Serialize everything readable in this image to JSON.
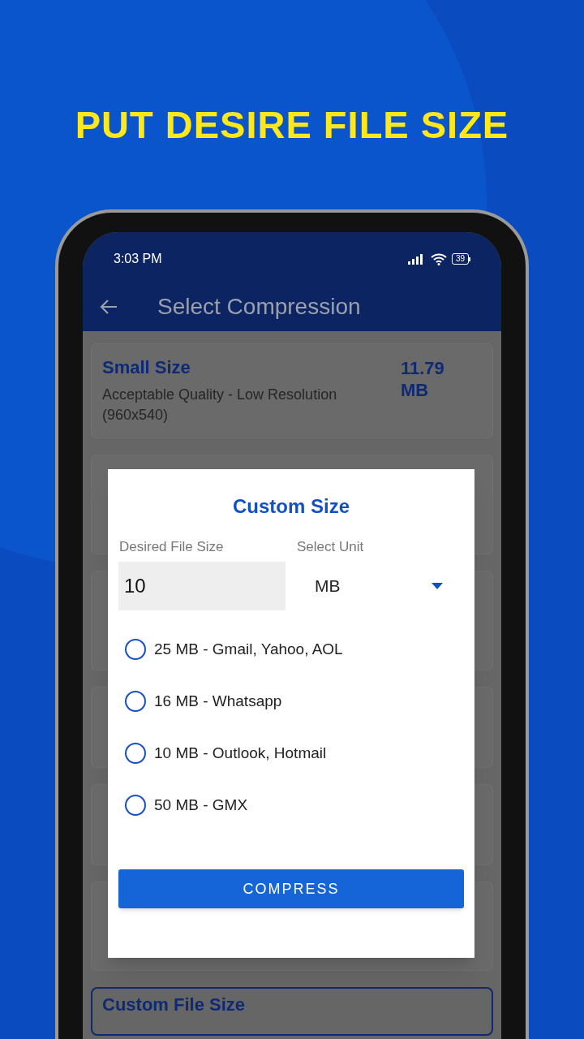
{
  "headline": "PUT DESIRE FILE SIZE",
  "status_bar": {
    "time": "3:03 PM",
    "battery": "39"
  },
  "app_bar": {
    "title": "Select Compression"
  },
  "first_option": {
    "title": "Small Size",
    "lines": [
      "Acceptable Quality - Low Resolution",
      "(960x540)"
    ],
    "size": "11.79 MB"
  },
  "custom_card": {
    "title": "Custom File Size"
  },
  "dialog": {
    "title": "Custom Size",
    "size_field": {
      "label": "Desired File Size",
      "value": "10"
    },
    "unit_select": {
      "label": "Select Unit",
      "value": "MB"
    },
    "presets": [
      {
        "label": "25 MB - Gmail, Yahoo, AOL",
        "selected": false
      },
      {
        "label": "16 MB - Whatsapp",
        "selected": false
      },
      {
        "label": "10 MB - Outlook, Hotmail",
        "selected": false
      },
      {
        "label": "50 MB - GMX",
        "selected": false
      }
    ],
    "button": "COMPRESS"
  }
}
